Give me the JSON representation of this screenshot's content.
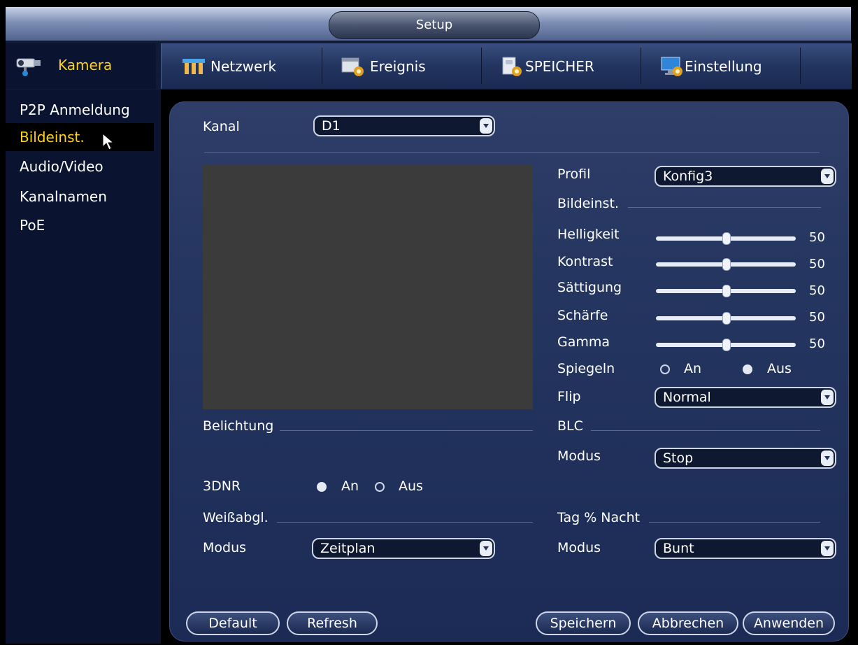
{
  "window": {
    "title": "Setup"
  },
  "nav": {
    "left_tab": {
      "label": "Kamera",
      "icon": "camera-icon"
    },
    "tabs": [
      {
        "label": "Netzwerk",
        "icon": "network-icon"
      },
      {
        "label": "Ereignis",
        "icon": "event-icon"
      },
      {
        "label": "SPEICHER",
        "icon": "storage-icon"
      },
      {
        "label": "Einstellung",
        "icon": "settings-monitor-icon"
      }
    ]
  },
  "sidebar": {
    "items": [
      {
        "label": "P2P Anmeldung",
        "active": false
      },
      {
        "label": "Bildeinst.",
        "active": true
      },
      {
        "label": "Audio/Video",
        "active": false
      },
      {
        "label": "Kanalnamen",
        "active": false
      },
      {
        "label": "PoE",
        "active": false
      }
    ]
  },
  "form": {
    "channel": {
      "label": "Kanal",
      "value": "D1"
    },
    "profile": {
      "label": "Profil",
      "value": "Konfig3"
    },
    "image_section": "Bildeinst.",
    "sliders": [
      {
        "label": "Helligkeit",
        "value": "50",
        "level": 50
      },
      {
        "label": "Kontrast",
        "value": "50",
        "level": 50
      },
      {
        "label": "Sättigung",
        "value": "50",
        "level": 50
      },
      {
        "label": "Schärfe",
        "value": "50",
        "level": 50
      },
      {
        "label": "Gamma",
        "value": "50",
        "level": 50
      }
    ],
    "mirror": {
      "label": "Spiegeln",
      "on_label": "An",
      "off_label": "Aus",
      "selected": "Aus"
    },
    "flip": {
      "label": "Flip",
      "value": "Normal"
    },
    "exposure_section": "Belichtung",
    "blc_section": "BLC",
    "blc_mode": {
      "label": "Modus",
      "value": "Stop"
    },
    "dnr": {
      "label": "3DNR",
      "on_label": "An",
      "off_label": "Aus",
      "selected": "An"
    },
    "white_balance_section": "Weißabgl.",
    "white_balance_mode": {
      "label": "Modus",
      "value": "Zeitplan"
    },
    "day_night_section": "Tag % Nacht",
    "day_night_mode": {
      "label": "Modus",
      "value": "Bunt"
    }
  },
  "buttons": {
    "default": "Default",
    "refresh": "Refresh",
    "save": "Speichern",
    "cancel": "Abbrechen",
    "apply": "Anwenden"
  },
  "colors": {
    "active_text": "#ffd21a",
    "panel": "#253660",
    "preview": "#3b3b3b"
  }
}
